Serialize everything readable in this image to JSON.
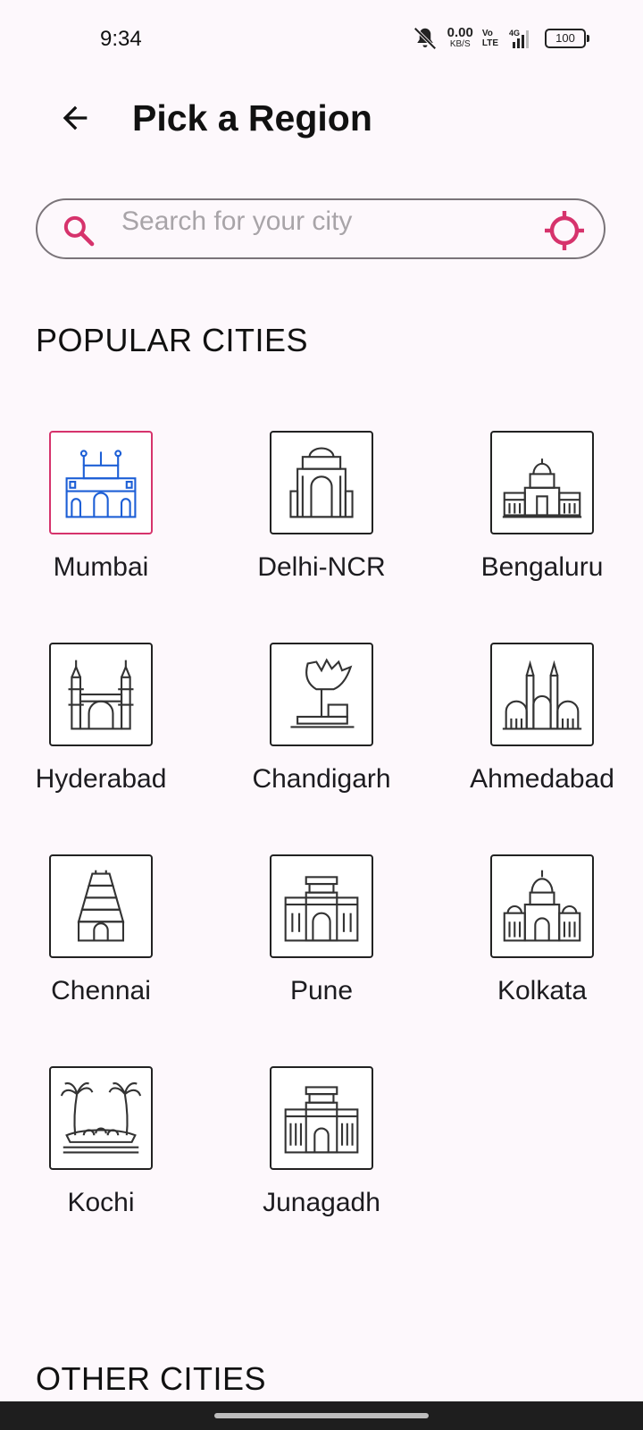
{
  "status_bar": {
    "time": "9:34",
    "net_speed": "0.00",
    "net_unit": "KB/S",
    "volte_top": "Vo",
    "volte_bottom": "LTE",
    "network": "4G",
    "battery": "100",
    "icons": [
      "mute-icon",
      "signal-icon",
      "battery-icon"
    ]
  },
  "app_bar": {
    "title": "Pick a Region",
    "back_icon": "arrow-left-icon"
  },
  "search": {
    "placeholder": "Search for your city",
    "value": "",
    "accent_color": "#d6336c"
  },
  "popular": {
    "title": "POPULAR CITIES",
    "cities": [
      {
        "name": "Mumbai",
        "icon": "gateway-of-india-icon",
        "selected": true
      },
      {
        "name": "Delhi-NCR",
        "icon": "india-gate-icon",
        "selected": false
      },
      {
        "name": "Bengaluru",
        "icon": "vidhana-soudha-icon",
        "selected": false
      },
      {
        "name": "Hyderabad",
        "icon": "charminar-icon",
        "selected": false
      },
      {
        "name": "Chandigarh",
        "icon": "open-hand-monument-icon",
        "selected": false
      },
      {
        "name": "Ahmedabad",
        "icon": "mosque-icon",
        "selected": false
      },
      {
        "name": "Chennai",
        "icon": "temple-gopuram-icon",
        "selected": false
      },
      {
        "name": "Pune",
        "icon": "shaniwar-wada-icon",
        "selected": false
      },
      {
        "name": "Kolkata",
        "icon": "victoria-memorial-icon",
        "selected": false
      },
      {
        "name": "Kochi",
        "icon": "palm-trees-icon",
        "selected": false
      },
      {
        "name": "Junagadh",
        "icon": "fort-gate-icon",
        "selected": false
      }
    ]
  },
  "other": {
    "title": "OTHER CITIES"
  }
}
